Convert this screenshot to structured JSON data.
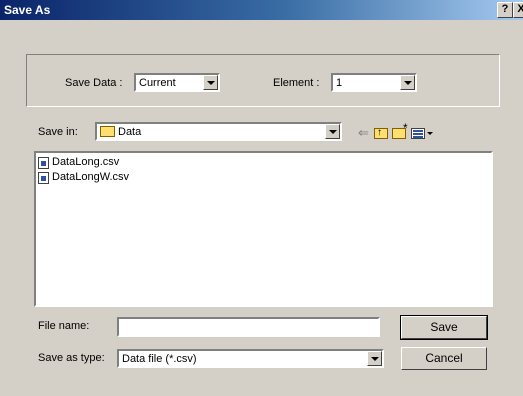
{
  "window": {
    "title": "Save As",
    "help_label": "?",
    "close_label": "X"
  },
  "save_options": {
    "save_data_label": "Save Data :",
    "save_data_value": "Current",
    "element_label": "Element :",
    "element_value": "1"
  },
  "location": {
    "save_in_label": "Save in:",
    "save_in_value": "Data"
  },
  "toolbar_icons": [
    "back-arrow-icon",
    "up-one-level-icon",
    "create-new-folder-icon",
    "view-menu-icon"
  ],
  "files": [
    {
      "name": "DataLong.csv",
      "icon": "csv-file-icon"
    },
    {
      "name": "DataLongW.csv",
      "icon": "csv-file-icon"
    }
  ],
  "file_name": {
    "label": "File name:",
    "value": ""
  },
  "file_type": {
    "label": "Save as type:",
    "value": "Data file (*.csv)"
  },
  "buttons": {
    "save": "Save",
    "cancel": "Cancel"
  }
}
